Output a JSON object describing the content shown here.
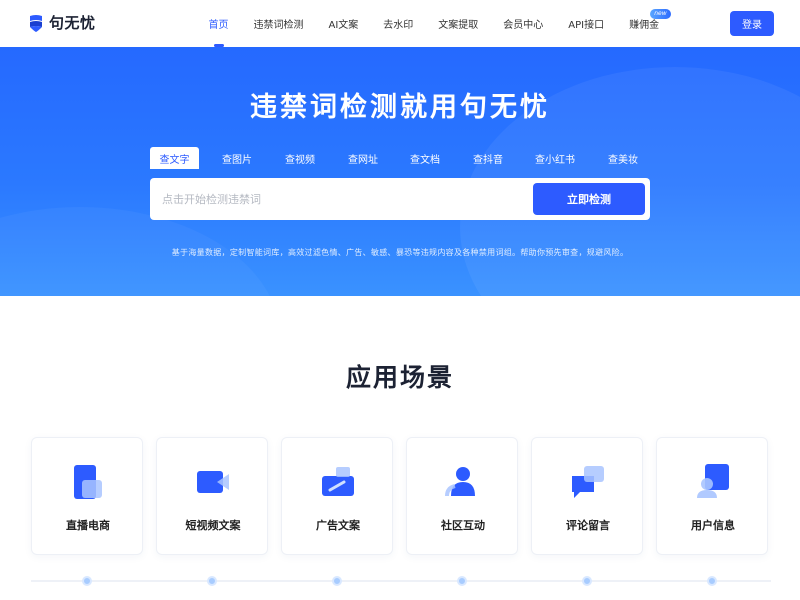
{
  "brand": {
    "name": "句无忧"
  },
  "nav": {
    "items": [
      {
        "label": "首页",
        "active": true
      },
      {
        "label": "违禁词检测"
      },
      {
        "label": "AI文案"
      },
      {
        "label": "去水印"
      },
      {
        "label": "文案提取"
      },
      {
        "label": "会员中心"
      },
      {
        "label": "API接口"
      },
      {
        "label": "赚佣金",
        "badge": "new"
      }
    ],
    "login_label": "登录"
  },
  "hero": {
    "title": "违禁词检测就用句无忧",
    "tabs": [
      "查文字",
      "查图片",
      "查视频",
      "查网址",
      "查文档",
      "查抖音",
      "查小红书",
      "查美妆"
    ],
    "active_tab": "查文字",
    "search": {
      "placeholder": "点击开始检测违禁词",
      "value": ""
    },
    "button_label": "立即检测",
    "description": "基于海量数据，定制智能词库，高效过滤色情、广告、敏感、暴恐等违规内容及各种禁用词组。帮助你预先审查，规避风险。"
  },
  "section": {
    "title": "应用场景",
    "cards": [
      {
        "label": "直播电商",
        "icon": "phone-icon"
      },
      {
        "label": "短视频文案",
        "icon": "video-icon"
      },
      {
        "label": "广告文案",
        "icon": "ad-icon"
      },
      {
        "label": "社区互动",
        "icon": "community-icon"
      },
      {
        "label": "评论留言",
        "icon": "comment-icon"
      },
      {
        "label": "用户信息",
        "icon": "user-info-icon"
      }
    ]
  },
  "colors": {
    "primary": "#2d5bff",
    "hero_top": "#2569ff",
    "hero_bottom": "#3a92ff"
  }
}
